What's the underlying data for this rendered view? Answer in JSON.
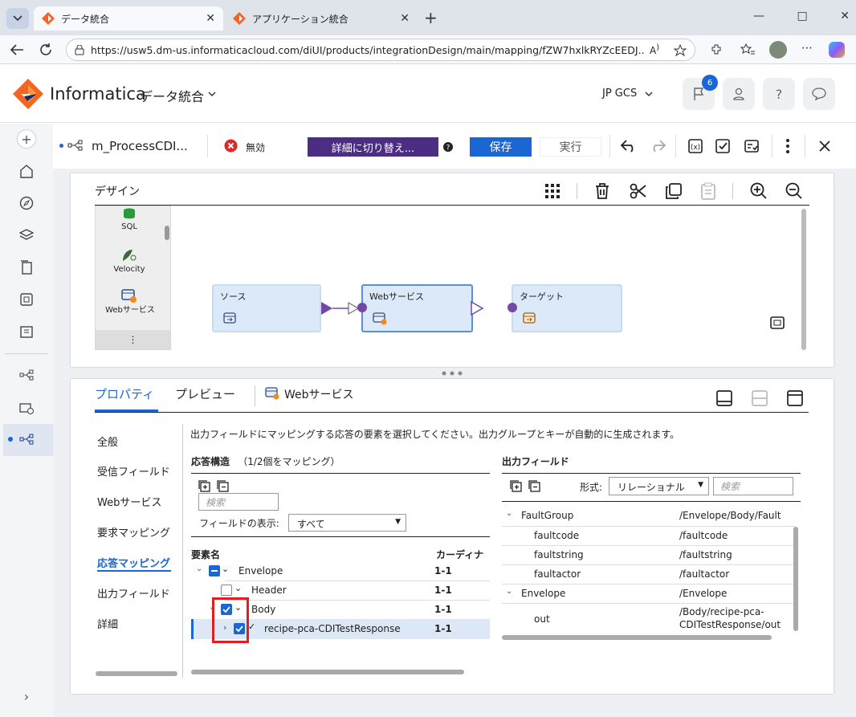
{
  "browser": {
    "tabs": [
      {
        "label": "データ統合"
      },
      {
        "label": "アプリケーション統合"
      }
    ],
    "new_tab": "+",
    "url": "https://usw5.dm-us.informaticacloud.com/diUI/products/integrationDesign/main/mapping/fZW7hxlkRYZcEEDJ...",
    "window_controls": [
      "—",
      "□",
      "✕"
    ]
  },
  "app": {
    "brand": "Informatica",
    "service": "データ統合",
    "org": "JP GCS",
    "notification_count": "6"
  },
  "toolbar": {
    "mapping_name": "m_ProcessCDI...",
    "status": "無効",
    "switch_button": "詳細に切り替え...",
    "save_button": "保存",
    "run_button": "実行"
  },
  "design": {
    "title": "デザイン",
    "palette": [
      {
        "label": "SQL"
      },
      {
        "label": "Velocity"
      },
      {
        "label": "Webサービス"
      }
    ],
    "palette_more": "⋮",
    "nodes": [
      {
        "label": "ソース"
      },
      {
        "label": "Webサービス"
      },
      {
        "label": "ターゲット"
      }
    ]
  },
  "properties": {
    "tabs": [
      "プロパティ",
      "プレビュー"
    ],
    "object_label": "Webサービス",
    "nav": [
      "全般",
      "受信フィールド",
      "Webサービス",
      "要求マッピング",
      "応答マッピング",
      "出力フィールド",
      "詳細"
    ],
    "description": "出力フィールドにマッピングする応答の要素を選択してください。出力グループとキーが自動的に生成されます。",
    "response": {
      "title": "応答構造",
      "mapped_count": "（1/2個をマッピング）",
      "search_placeholder": "検索",
      "filter_label": "フィールドの表示:",
      "filter_value": "すべて",
      "col_name": "要素名",
      "col_card": "カーディナ",
      "rows": [
        {
          "name": "Envelope",
          "card": "1-1"
        },
        {
          "name": "Header",
          "card": "1-1"
        },
        {
          "name": "Body",
          "card": "1-1"
        },
        {
          "name": "recipe-pca-CDITestResponse",
          "card": "1-1"
        }
      ]
    },
    "output": {
      "title": "出力フィールド",
      "format_label": "形式:",
      "format_value": "リレーショナル",
      "search_placeholder": "検索",
      "rows": [
        {
          "name": "FaultGroup",
          "path": "/Envelope/Body/Fault"
        },
        {
          "name": "faultcode",
          "path": "/faultcode"
        },
        {
          "name": "faultstring",
          "path": "/faultstring"
        },
        {
          "name": "faultactor",
          "path": "/faultactor"
        },
        {
          "name": "Envelope",
          "path": "/Envelope"
        },
        {
          "name": "out",
          "path": "/Body/recipe-pca-CDITestResponse/out"
        }
      ]
    }
  },
  "colors": {
    "accent": "#1a66d2",
    "purple_button": "#4b2e83",
    "highlight": "#e02020"
  }
}
